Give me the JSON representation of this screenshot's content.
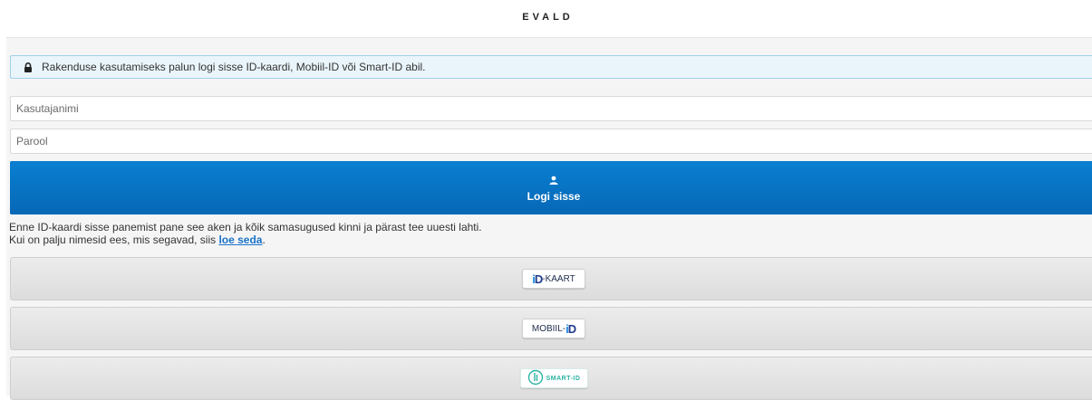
{
  "header": {
    "brand": "EVALD"
  },
  "notice": {
    "text": "Rakenduse kasutamiseks palun logi sisse ID-kaardi, Mobiil-ID või Smart-ID abil.",
    "icon": "lock-icon"
  },
  "form": {
    "username_placeholder": "Kasutajanimi",
    "password_placeholder": "Parool",
    "username_value": "",
    "password_value": ""
  },
  "login_button": {
    "label": "Logi sisse",
    "icon": "user-icon"
  },
  "help": {
    "line1": "Enne ID-kaardi sisse panemist pane see aken ja kõik samasugused kinni ja pärast tee uuesti lahti.",
    "line2_prefix": "Kui on palju nimesid ees, mis segavad, siis ",
    "link_text": "loe seda",
    "line2_suffix": "."
  },
  "auth_options": {
    "idkaart": {
      "text": "-KAART",
      "logo": "iD"
    },
    "mobiil": {
      "text": "MOBIIL-",
      "logo": "iD"
    },
    "smart": {
      "text": "SMART-ID"
    }
  },
  "colors": {
    "primary": "#0668b6",
    "notice_bg": "#eaf5fb",
    "notice_border": "#9fd0ea",
    "link": "#1a73c8",
    "smart_teal": "#2bb3a3"
  }
}
